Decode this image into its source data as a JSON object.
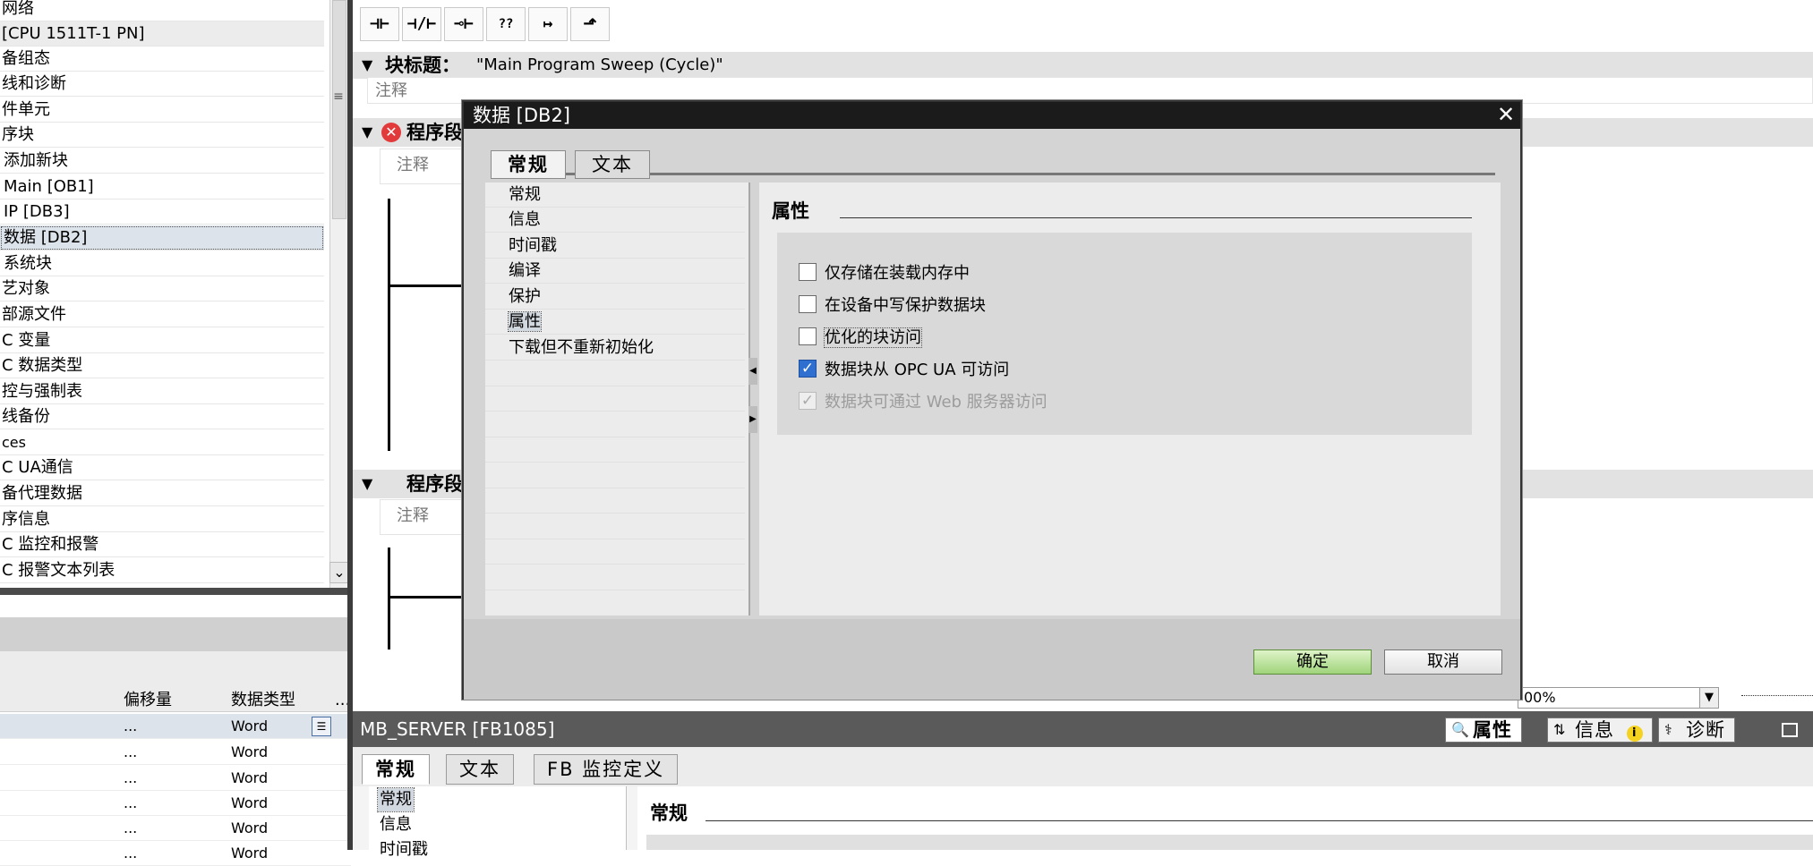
{
  "project_tree": {
    "items": [
      {
        "label": "网络",
        "state": "normal"
      },
      {
        "label": "[CPU 1511T-1 PN]",
        "state": "dark"
      },
      {
        "label": "备组态",
        "state": "normal"
      },
      {
        "label": "线和诊断",
        "state": "normal"
      },
      {
        "label": "件单元",
        "state": "normal"
      },
      {
        "label": "序块",
        "state": "normal"
      },
      {
        "label": "添加新块",
        "state": "normal"
      },
      {
        "label": "Main [OB1]",
        "state": "normal"
      },
      {
        "label": "IP [DB3]",
        "state": "normal"
      },
      {
        "label": "数据 [DB2]",
        "state": "selected"
      },
      {
        "label": "系统块",
        "state": "normal"
      },
      {
        "label": "艺对象",
        "state": "normal"
      },
      {
        "label": "部源文件",
        "state": "normal"
      },
      {
        "label": "C 变量",
        "state": "normal"
      },
      {
        "label": "C 数据类型",
        "state": "normal"
      },
      {
        "label": "控与强制表",
        "state": "normal"
      },
      {
        "label": "线备份",
        "state": "normal"
      },
      {
        "label": "ces",
        "state": "normal"
      },
      {
        "label": "C UA通信",
        "state": "normal"
      },
      {
        "label": "备代理数据",
        "state": "normal"
      },
      {
        "label": "序信息",
        "state": "normal"
      },
      {
        "label": "C 监控和报警",
        "state": "normal"
      },
      {
        "label": "C 报警文本列表",
        "state": "normal"
      }
    ]
  },
  "details": {
    "col_offset": "偏移量",
    "col_type": "数据类型",
    "col_more": "...",
    "rows": [
      {
        "offset": "...",
        "type": "Word"
      },
      {
        "offset": "...",
        "type": "Word"
      },
      {
        "offset": "...",
        "type": "Word"
      },
      {
        "offset": "...",
        "type": "Word"
      },
      {
        "offset": "...",
        "type": "Word"
      },
      {
        "offset": "...",
        "type": "Word"
      }
    ]
  },
  "editor": {
    "toolbar": [
      "⊣⊢",
      "⊣/⊢",
      "⊸⊢",
      "??",
      "↦",
      "⬏"
    ],
    "block_title_label": "块标题：",
    "block_title_value": "\"Main Program Sweep (Cycle)\"",
    "comment_placeholder": "注释",
    "network_label": "程序段"
  },
  "dialog": {
    "title": "数据 [DB2]",
    "tabs": [
      "常规",
      "文本"
    ],
    "nav": [
      "常规",
      "信息",
      "时间戳",
      "编译",
      "保护",
      "属性",
      "下载但不重新初始化"
    ],
    "selected_nav": "属性",
    "section_title": "属性",
    "checkboxes": [
      {
        "label": "仅存储在装载内存中",
        "checked": false,
        "disabled": false
      },
      {
        "label": "在设备中写保护数据块",
        "checked": false,
        "disabled": false
      },
      {
        "label": "优化的块访问",
        "checked": false,
        "disabled": false
      },
      {
        "label": "数据块从 OPC UA 可访问",
        "checked": true,
        "disabled": false
      },
      {
        "label": "数据块可通过 Web 服务器访问",
        "checked": true,
        "disabled": true
      }
    ],
    "ok_label": "确定",
    "cancel_label": "取消"
  },
  "zoom": {
    "value": "00%"
  },
  "inspector": {
    "title": "MB_SERVER [FB1085]",
    "right_tabs": [
      "属性",
      "信息",
      "诊断"
    ],
    "tabs": [
      "常规",
      "文本",
      "FB 监控定义"
    ],
    "nav": [
      "常规",
      "信息",
      "时间戳"
    ],
    "section_title": "常规"
  },
  "colors": {
    "ok_button": "#9fd47a",
    "title_bar": "#1b1b1b",
    "checkbox_checked": "#2f6fd0",
    "error": "#e23a3a"
  }
}
